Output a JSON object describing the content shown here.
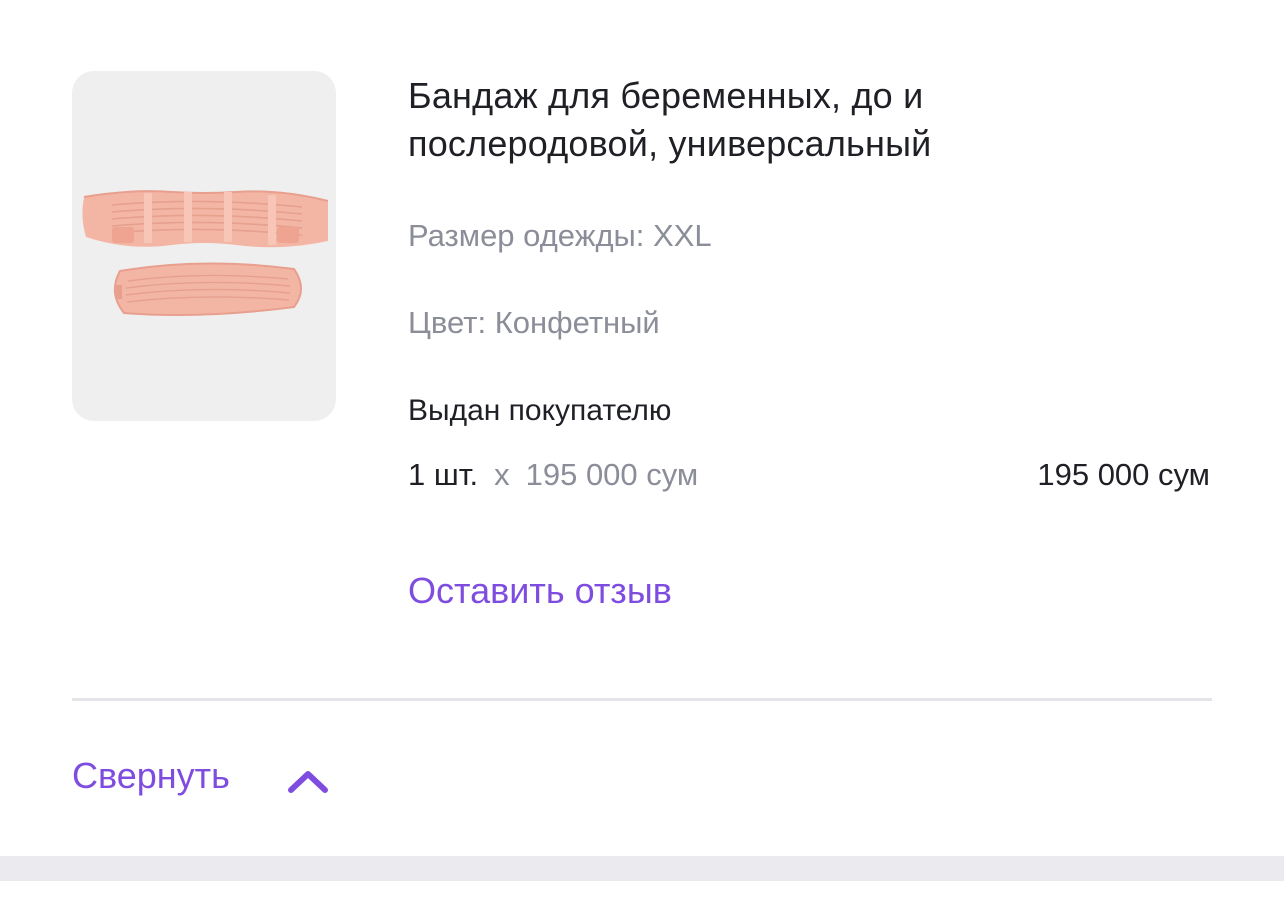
{
  "product": {
    "title": "Бандаж для беременных, до и послеродовой, универсальный",
    "image_icon": "maternity-belt-image",
    "size_attr": "Размер одежды: XXL",
    "color_attr": "Цвет: Конфетный",
    "status": "Выдан покупателю",
    "quantity": "1 шт.",
    "times": "x",
    "unit_price": "195 000 сум",
    "total_price": "195 000 сум",
    "review_link": "Оставить отзыв"
  },
  "footer": {
    "collapse_label": "Свернуть",
    "collapse_icon": "chevron-up-icon"
  },
  "colors": {
    "accent": "#7f4ce0",
    "text_primary": "#1f2026",
    "text_secondary": "#8b8e99",
    "product_tint": "#f4b6a4"
  }
}
